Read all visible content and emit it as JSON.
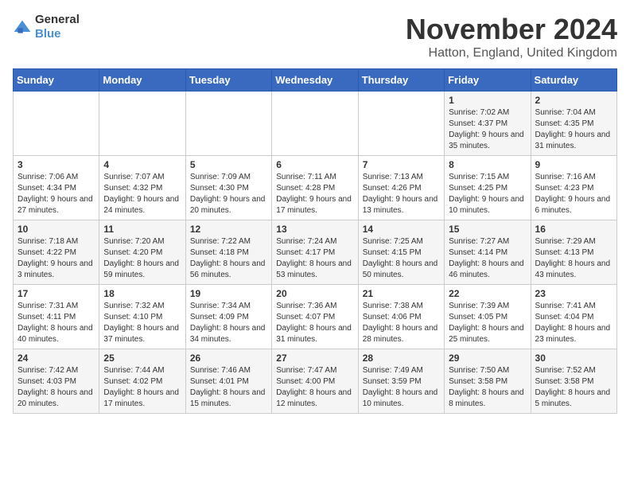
{
  "logo": {
    "general": "General",
    "blue": "Blue"
  },
  "title": "November 2024",
  "location": "Hatton, England, United Kingdom",
  "days_of_week": [
    "Sunday",
    "Monday",
    "Tuesday",
    "Wednesday",
    "Thursday",
    "Friday",
    "Saturday"
  ],
  "weeks": [
    [
      {
        "day": "",
        "sunrise": "",
        "sunset": "",
        "daylight": ""
      },
      {
        "day": "",
        "sunrise": "",
        "sunset": "",
        "daylight": ""
      },
      {
        "day": "",
        "sunrise": "",
        "sunset": "",
        "daylight": ""
      },
      {
        "day": "",
        "sunrise": "",
        "sunset": "",
        "daylight": ""
      },
      {
        "day": "",
        "sunrise": "",
        "sunset": "",
        "daylight": ""
      },
      {
        "day": "1",
        "sunrise": "Sunrise: 7:02 AM",
        "sunset": "Sunset: 4:37 PM",
        "daylight": "Daylight: 9 hours and 35 minutes."
      },
      {
        "day": "2",
        "sunrise": "Sunrise: 7:04 AM",
        "sunset": "Sunset: 4:35 PM",
        "daylight": "Daylight: 9 hours and 31 minutes."
      }
    ],
    [
      {
        "day": "3",
        "sunrise": "Sunrise: 7:06 AM",
        "sunset": "Sunset: 4:34 PM",
        "daylight": "Daylight: 9 hours and 27 minutes."
      },
      {
        "day": "4",
        "sunrise": "Sunrise: 7:07 AM",
        "sunset": "Sunset: 4:32 PM",
        "daylight": "Daylight: 9 hours and 24 minutes."
      },
      {
        "day": "5",
        "sunrise": "Sunrise: 7:09 AM",
        "sunset": "Sunset: 4:30 PM",
        "daylight": "Daylight: 9 hours and 20 minutes."
      },
      {
        "day": "6",
        "sunrise": "Sunrise: 7:11 AM",
        "sunset": "Sunset: 4:28 PM",
        "daylight": "Daylight: 9 hours and 17 minutes."
      },
      {
        "day": "7",
        "sunrise": "Sunrise: 7:13 AM",
        "sunset": "Sunset: 4:26 PM",
        "daylight": "Daylight: 9 hours and 13 minutes."
      },
      {
        "day": "8",
        "sunrise": "Sunrise: 7:15 AM",
        "sunset": "Sunset: 4:25 PM",
        "daylight": "Daylight: 9 hours and 10 minutes."
      },
      {
        "day": "9",
        "sunrise": "Sunrise: 7:16 AM",
        "sunset": "Sunset: 4:23 PM",
        "daylight": "Daylight: 9 hours and 6 minutes."
      }
    ],
    [
      {
        "day": "10",
        "sunrise": "Sunrise: 7:18 AM",
        "sunset": "Sunset: 4:22 PM",
        "daylight": "Daylight: 9 hours and 3 minutes."
      },
      {
        "day": "11",
        "sunrise": "Sunrise: 7:20 AM",
        "sunset": "Sunset: 4:20 PM",
        "daylight": "Daylight: 8 hours and 59 minutes."
      },
      {
        "day": "12",
        "sunrise": "Sunrise: 7:22 AM",
        "sunset": "Sunset: 4:18 PM",
        "daylight": "Daylight: 8 hours and 56 minutes."
      },
      {
        "day": "13",
        "sunrise": "Sunrise: 7:24 AM",
        "sunset": "Sunset: 4:17 PM",
        "daylight": "Daylight: 8 hours and 53 minutes."
      },
      {
        "day": "14",
        "sunrise": "Sunrise: 7:25 AM",
        "sunset": "Sunset: 4:15 PM",
        "daylight": "Daylight: 8 hours and 50 minutes."
      },
      {
        "day": "15",
        "sunrise": "Sunrise: 7:27 AM",
        "sunset": "Sunset: 4:14 PM",
        "daylight": "Daylight: 8 hours and 46 minutes."
      },
      {
        "day": "16",
        "sunrise": "Sunrise: 7:29 AM",
        "sunset": "Sunset: 4:13 PM",
        "daylight": "Daylight: 8 hours and 43 minutes."
      }
    ],
    [
      {
        "day": "17",
        "sunrise": "Sunrise: 7:31 AM",
        "sunset": "Sunset: 4:11 PM",
        "daylight": "Daylight: 8 hours and 40 minutes."
      },
      {
        "day": "18",
        "sunrise": "Sunrise: 7:32 AM",
        "sunset": "Sunset: 4:10 PM",
        "daylight": "Daylight: 8 hours and 37 minutes."
      },
      {
        "day": "19",
        "sunrise": "Sunrise: 7:34 AM",
        "sunset": "Sunset: 4:09 PM",
        "daylight": "Daylight: 8 hours and 34 minutes."
      },
      {
        "day": "20",
        "sunrise": "Sunrise: 7:36 AM",
        "sunset": "Sunset: 4:07 PM",
        "daylight": "Daylight: 8 hours and 31 minutes."
      },
      {
        "day": "21",
        "sunrise": "Sunrise: 7:38 AM",
        "sunset": "Sunset: 4:06 PM",
        "daylight": "Daylight: 8 hours and 28 minutes."
      },
      {
        "day": "22",
        "sunrise": "Sunrise: 7:39 AM",
        "sunset": "Sunset: 4:05 PM",
        "daylight": "Daylight: 8 hours and 25 minutes."
      },
      {
        "day": "23",
        "sunrise": "Sunrise: 7:41 AM",
        "sunset": "Sunset: 4:04 PM",
        "daylight": "Daylight: 8 hours and 23 minutes."
      }
    ],
    [
      {
        "day": "24",
        "sunrise": "Sunrise: 7:42 AM",
        "sunset": "Sunset: 4:03 PM",
        "daylight": "Daylight: 8 hours and 20 minutes."
      },
      {
        "day": "25",
        "sunrise": "Sunrise: 7:44 AM",
        "sunset": "Sunset: 4:02 PM",
        "daylight": "Daylight: 8 hours and 17 minutes."
      },
      {
        "day": "26",
        "sunrise": "Sunrise: 7:46 AM",
        "sunset": "Sunset: 4:01 PM",
        "daylight": "Daylight: 8 hours and 15 minutes."
      },
      {
        "day": "27",
        "sunrise": "Sunrise: 7:47 AM",
        "sunset": "Sunset: 4:00 PM",
        "daylight": "Daylight: 8 hours and 12 minutes."
      },
      {
        "day": "28",
        "sunrise": "Sunrise: 7:49 AM",
        "sunset": "Sunset: 3:59 PM",
        "daylight": "Daylight: 8 hours and 10 minutes."
      },
      {
        "day": "29",
        "sunrise": "Sunrise: 7:50 AM",
        "sunset": "Sunset: 3:58 PM",
        "daylight": "Daylight: 8 hours and 8 minutes."
      },
      {
        "day": "30",
        "sunrise": "Sunrise: 7:52 AM",
        "sunset": "Sunset: 3:58 PM",
        "daylight": "Daylight: 8 hours and 5 minutes."
      }
    ]
  ]
}
